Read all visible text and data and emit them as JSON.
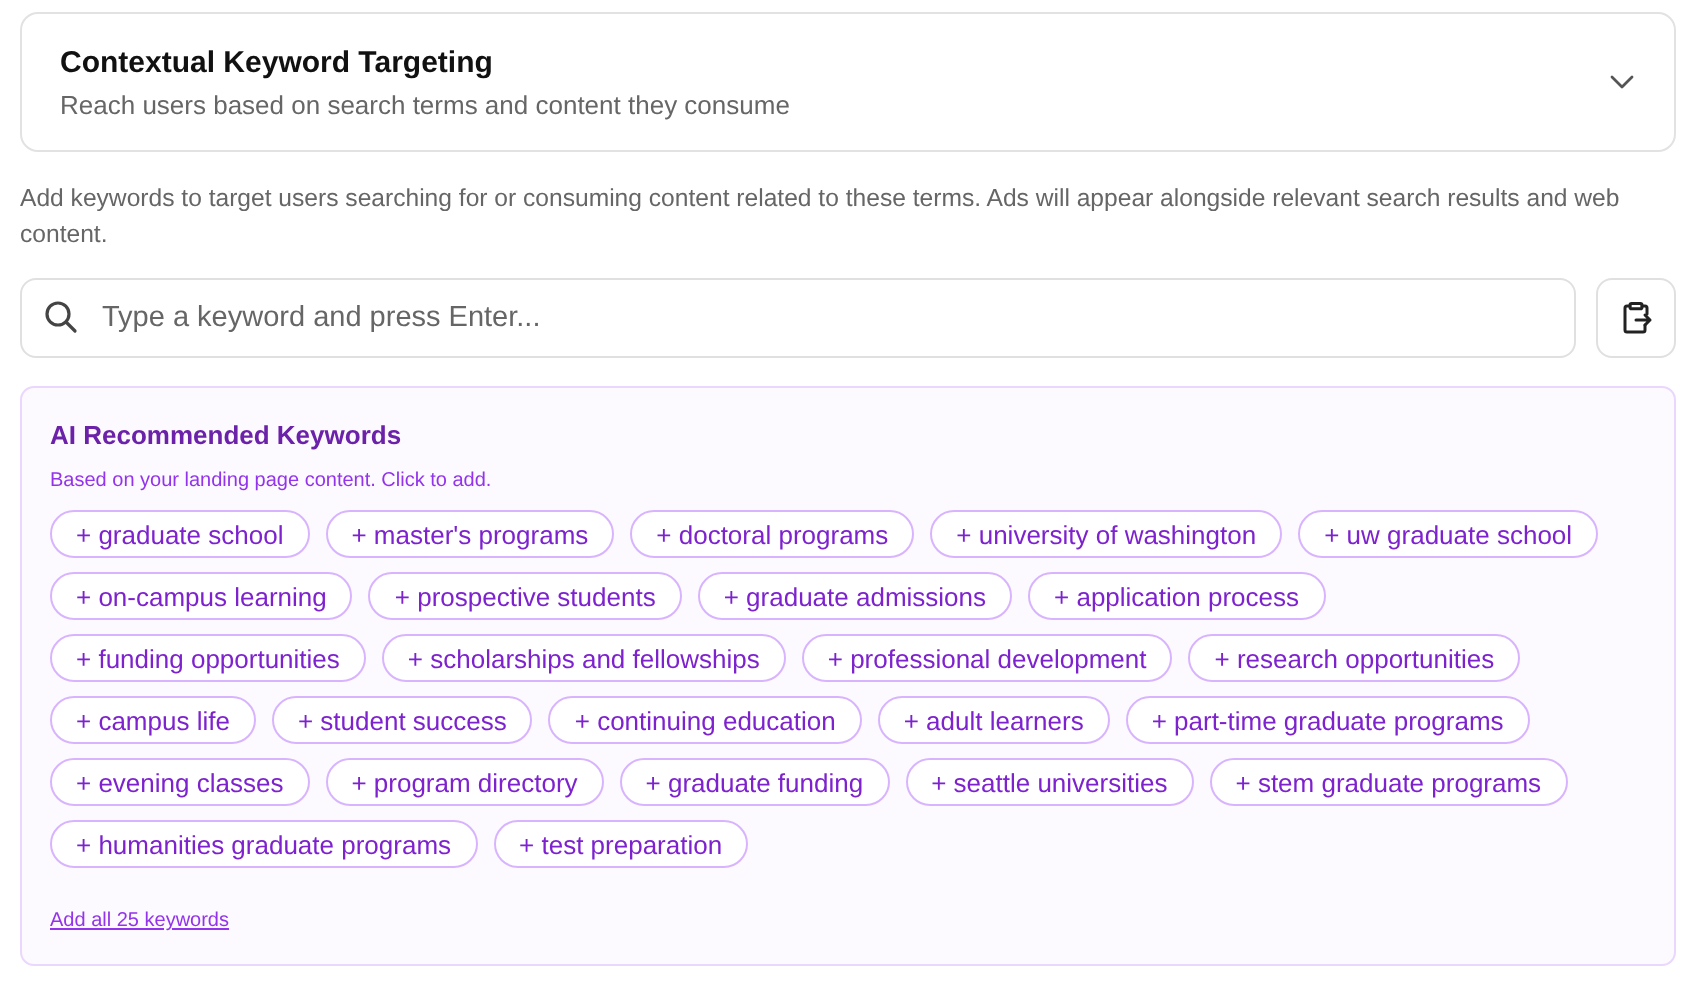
{
  "section": {
    "title": "Contextual Keyword Targeting",
    "subtitle": "Reach users based on search terms and content they consume",
    "expanded": false
  },
  "description": "Add keywords to target users searching for or consuming content related to these terms. Ads will appear alongside relevant search results and web content.",
  "search": {
    "placeholder": "Type a keyword and press Enter..."
  },
  "recommendations": {
    "title": "AI Recommended Keywords",
    "subtitle": "Based on your landing page content. Click to add.",
    "keywords": [
      "+ graduate school",
      "+ master's programs",
      "+ doctoral programs",
      "+ university of washington",
      "+ uw graduate school",
      "+ on-campus learning",
      "+ prospective students",
      "+ graduate admissions",
      "+ application process",
      "+ funding opportunities",
      "+ scholarships and fellowships",
      "+ professional development",
      "+ research opportunities",
      "+ campus life",
      "+ student success",
      "+ continuing education",
      "+ adult learners",
      "+ part-time graduate programs",
      "+ evening classes",
      "+ program directory",
      "+ graduate funding",
      "+ seattle universities",
      "+ stem graduate programs",
      "+ humanities graduate programs",
      "+ test preparation"
    ],
    "add_all": "Add all 25 keywords"
  }
}
